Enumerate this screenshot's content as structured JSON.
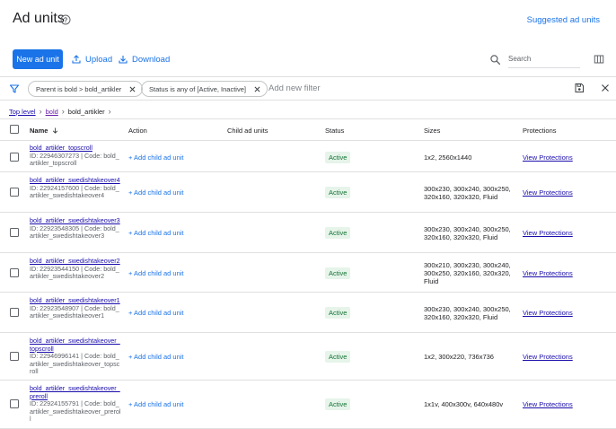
{
  "header": {
    "title": "Ad units",
    "suggested_link": "Suggested ad units"
  },
  "toolbar": {
    "new_button": "New ad unit",
    "upload": "Upload",
    "download": "Download",
    "search_placeholder": "Search"
  },
  "filters": {
    "chip1": "Parent is bold > bold_artikler",
    "chip2": "Status is any of [Active, Inactive]",
    "add_placeholder": "Add new filter"
  },
  "breadcrumb": {
    "top": "Top level",
    "parent": "bold",
    "current": "bold_artikler"
  },
  "table": {
    "columns": {
      "name": "Name",
      "action": "Action",
      "child": "Child ad units",
      "status": "Status",
      "sizes": "Sizes",
      "protections": "Protections"
    },
    "rows": [
      {
        "name": "bold_artikler_topscroll",
        "meta": "ID: 22946307273 | Code: bold_artikler_topscroll",
        "action": "+ Add child ad unit",
        "status": "Active",
        "sizes": "1x2, 2560x1440",
        "protections": "View Protections"
      },
      {
        "name": "bold_artikler_swedishtakeover4",
        "meta": "ID: 22924157600 | Code: bold_artikler_swedishtakeover4",
        "action": "+ Add child ad unit",
        "status": "Active",
        "sizes": "300x230, 300x240, 300x250, 320x160, 320x320, Fluid",
        "protections": "View Protections"
      },
      {
        "name": "bold_artikler_swedishtakeover3",
        "meta": "ID: 22923548305 | Code: bold_artikler_swedishtakeover3",
        "action": "+ Add child ad unit",
        "status": "Active",
        "sizes": "300x230, 300x240, 300x250, 320x160, 320x320, Fluid",
        "protections": "View Protections"
      },
      {
        "name": "bold_artikler_swedishtakeover2",
        "meta": "ID: 22923544150 | Code: bold_artikler_swedishtakeover2",
        "action": "+ Add child ad unit",
        "status": "Active",
        "sizes": "300x210, 300x230, 300x240, 300x250, 320x160, 320x320, Fluid",
        "protections": "View Protections"
      },
      {
        "name": "bold_artikler_swedishtakeover1",
        "meta": "ID: 22923548907 | Code: bold_artikler_swedishtakeover1",
        "action": "+ Add child ad unit",
        "status": "Active",
        "sizes": "300x230, 300x240, 300x250, 320x160, 320x320, Fluid",
        "protections": "View Protections"
      },
      {
        "name": "bold_artikler_swedishtakeover_topscroll",
        "meta": "ID: 22946996141 | Code: bold_artikler_swedishtakeover_topscroll",
        "action": "+ Add child ad unit",
        "status": "Active",
        "sizes": "1x2, 300x220, 736x736",
        "protections": "View Protections"
      },
      {
        "name": "bold_artikler_swedishtakeover_preroll",
        "meta": "ID: 22924155791 | Code: bold_artikler_swedishtakeover_preroll",
        "action": "+ Add child ad unit",
        "status": "Active",
        "sizes": "1x1v, 400x300v, 640x480v",
        "protections": "View Protections"
      }
    ]
  },
  "colors": {
    "primary": "#1a73e8",
    "link": "#1a0dab",
    "active_bg": "#e6f4ea",
    "active_text": "#137333"
  }
}
